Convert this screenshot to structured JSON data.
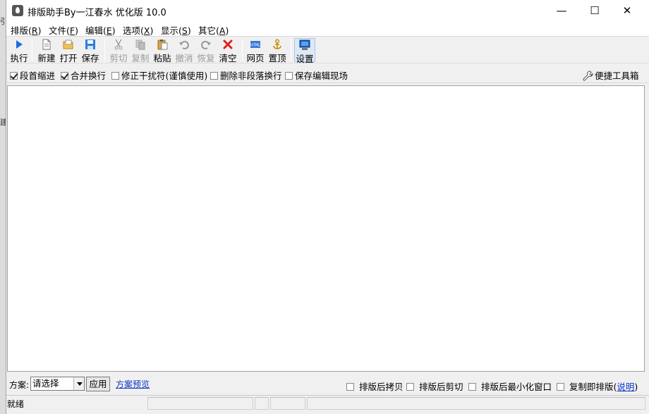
{
  "window": {
    "title": "排版助手By一江春水 优化版 10.0",
    "controls": {
      "minimize": "—",
      "maximize": "☐",
      "close": "✕"
    }
  },
  "menu": [
    {
      "label": "排版(",
      "key": "R",
      "suffix": ")"
    },
    {
      "label": "文件(",
      "key": "F",
      "suffix": ")"
    },
    {
      "label": "编辑(",
      "key": "E",
      "suffix": ")"
    },
    {
      "label": "选项(",
      "key": "X",
      "suffix": ")"
    },
    {
      "label": "显示(",
      "key": "S",
      "suffix": ")"
    },
    {
      "label": "其它(",
      "key": "A",
      "suffix": ")"
    }
  ],
  "toolbar": {
    "run": "执行",
    "new": "新建",
    "open": "打开",
    "save": "保存",
    "cut": "剪切",
    "copy": "复制",
    "paste": "粘贴",
    "undo": "撤消",
    "redo": "恢复",
    "clear": "清空",
    "web": "网页",
    "top": "置顶",
    "settings": "设置",
    "web_icon_text": "HTML"
  },
  "options": {
    "indent": {
      "label": "段首缩进",
      "checked": true
    },
    "merge": {
      "label": "合并换行",
      "checked": true
    },
    "fix": {
      "label": "修正干扰符(谨慎使用)",
      "checked": false
    },
    "delete_breaks": {
      "label": "删除非段落换行",
      "checked": false
    },
    "keep_scene": {
      "label": "保存编辑现场",
      "checked": false
    },
    "toolbox": "便捷工具箱"
  },
  "bottom": {
    "scheme_label": "方案:",
    "scheme_value": "请选择",
    "apply": "应用",
    "preview": "方案预览",
    "copy_after": "排版后拷贝",
    "cut_after": "排版后剪切",
    "minimize_after": "排版后最小化窗口",
    "copy_to_format": "复制即排版(",
    "explain": "说明",
    "copy_to_format_end": ")"
  },
  "status": {
    "text": "就绪"
  },
  "background": {
    "frag1": "引",
    "frag2": "建"
  },
  "colors": {
    "link": "#0b36c9",
    "accent_blue": "#1e6fd9",
    "clear_red": "#e02020"
  }
}
